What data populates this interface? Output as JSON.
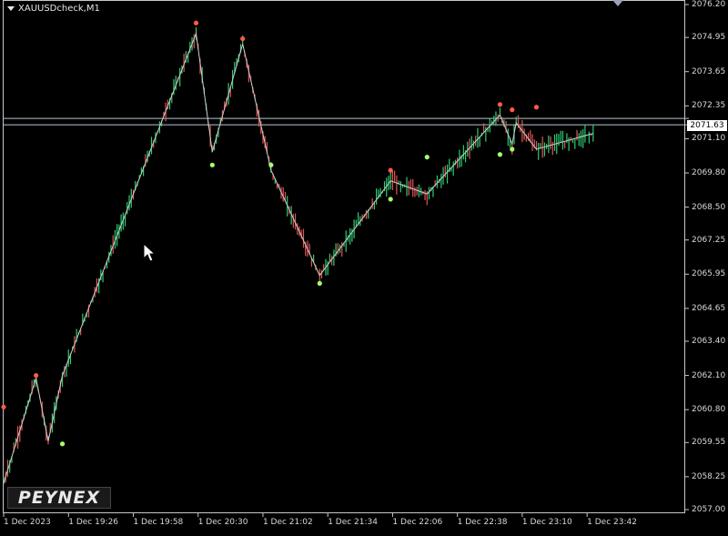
{
  "window": {
    "title": "XAUUSDcheck,M1"
  },
  "watermark": {
    "text": "PEYNEX"
  },
  "current_price": {
    "value": "2071.63"
  },
  "colors": {
    "background": "#000000",
    "up_bar": "#2ecc71",
    "down_bar": "#e05555",
    "zigzag": "#cfcfcf",
    "high_dot": "#ff5a46",
    "low_dot": "#a8ff6a"
  },
  "chart_data": {
    "type": "line",
    "title": "XAUUSDcheck,M1",
    "ylim": [
      2057.0,
      2076.2
    ],
    "y_ticks": [
      "2076.20",
      "2074.95",
      "2073.65",
      "2072.35",
      "2071.10",
      "2069.80",
      "2068.50",
      "2067.25",
      "2065.95",
      "2064.65",
      "2063.40",
      "2062.10",
      "2060.80",
      "2059.55",
      "2058.25",
      "2057.00"
    ],
    "x_ticks": [
      "1 Dec 2023",
      "1 Dec 19:26",
      "1 Dec 19:58",
      "1 Dec 20:30",
      "1 Dec 21:02",
      "1 Dec 21:34",
      "1 Dec 22:06",
      "1 Dec 22:38",
      "1 Dec 23:10",
      "1 Dec 23:42"
    ],
    "x_range": [
      0,
      336
    ],
    "horizontal_lines": [
      2071.87,
      2071.63
    ],
    "zigzag": {
      "x": [
        0,
        16,
        22,
        29,
        95,
        103,
        118,
        132,
        156,
        191,
        209,
        245,
        251,
        253,
        263,
        291
      ],
      "y": [
        2058.0,
        2062.0,
        2059.6,
        2062.1,
        2075.1,
        2070.6,
        2074.7,
        2069.9,
        2065.9,
        2069.5,
        2069.0,
        2072.0,
        2070.9,
        2071.7,
        2070.7,
        2071.3
      ]
    },
    "swing_highs": {
      "x": [
        0,
        16,
        95,
        118,
        191,
        245,
        251,
        263
      ],
      "y": [
        2060.9,
        2062.1,
        2075.5,
        2074.9,
        2069.9,
        2072.4,
        2072.2,
        2072.3
      ]
    },
    "swing_lows": {
      "x": [
        22,
        29,
        103,
        132,
        156,
        191,
        209,
        245,
        251
      ],
      "y": [
        2057.2,
        2059.5,
        2070.1,
        2070.1,
        2065.6,
        2068.8,
        2070.4,
        2070.5,
        2070.7
      ]
    }
  }
}
